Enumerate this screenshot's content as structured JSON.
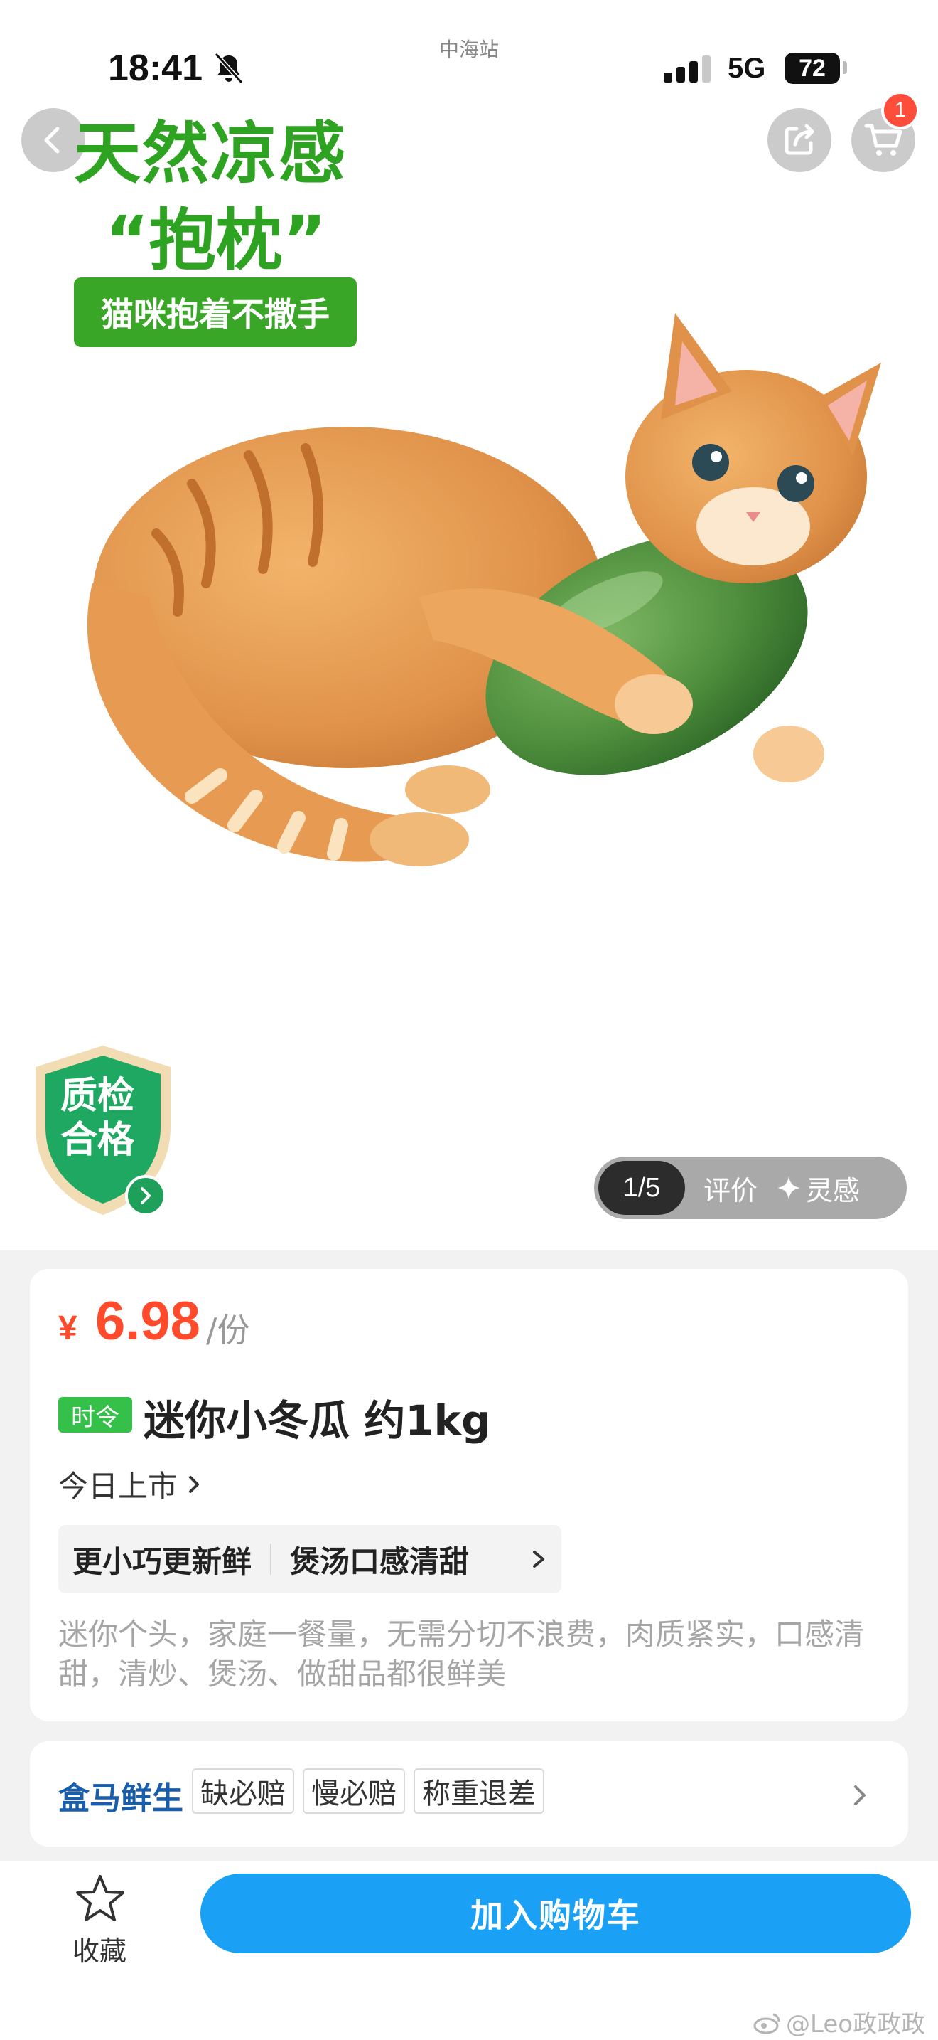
{
  "status_bar": {
    "time": "18:41",
    "carrier_label": "中海站",
    "network": "5G",
    "battery": "72"
  },
  "nav": {
    "cart_badge": "1"
  },
  "hero": {
    "promo_line1": "天然凉感",
    "promo_line2": "“抱枕”",
    "promo_pill": "猫咪抱着不撒手",
    "quality_badge": "质检合格",
    "pager": {
      "count": "1/5",
      "review": "评价",
      "inspiration": "灵感"
    }
  },
  "product": {
    "currency": "¥",
    "price": "6.98",
    "unit": "/份",
    "season_tag": "时令",
    "title": "迷你小冬瓜 约1kg",
    "launch": "今日上市",
    "features": [
      "更小巧更新鲜",
      "煲汤口感清甜"
    ],
    "description": "迷你个头，家庭一餐量，无需分切不浪费，肉质紧实，口感清甜，清炒、煲汤、做甜品都很鲜美"
  },
  "guarantee": {
    "brand": "盒马鲜生",
    "tags": [
      "缺必赔",
      "慢必赔",
      "称重退差"
    ]
  },
  "bottom": {
    "favorite": "收藏",
    "add_to_cart": "加入购物车"
  },
  "watermark": "@Leo政政政",
  "colors": {
    "price_red": "#ff4b2b",
    "promo_green": "#2ea321",
    "cta_blue": "#1aa0f5",
    "brand_blue": "#1a5dab",
    "badge_red": "#ff4d3b"
  }
}
